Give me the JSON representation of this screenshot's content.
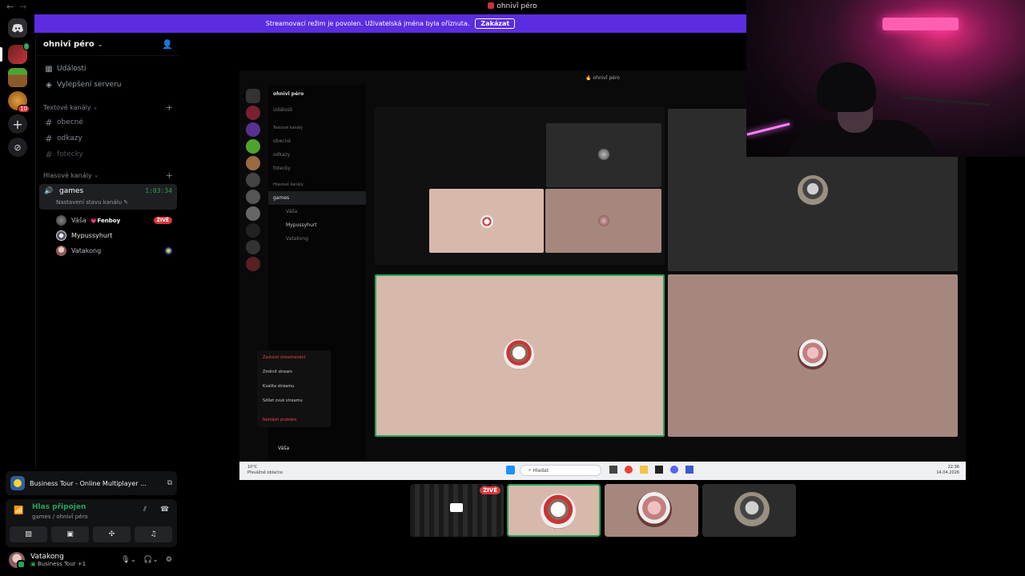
{
  "window": {
    "title": "ohnivî péro"
  },
  "banner": {
    "text": "Streamovací režim je povolen. Uživatelská jména byla oříznuta.",
    "button": "Zakázat"
  },
  "sidebar": {
    "server_name": "ohnivî péro",
    "nav": [
      {
        "label": "Události",
        "icon": "calendar-icon"
      },
      {
        "label": "Vylepšení serveru",
        "icon": "boost-icon"
      }
    ],
    "text_category": "Textové kanály",
    "text_channels": [
      "obecné",
      "odkazy",
      "fotecky"
    ],
    "voice_category": "Hlasové kanály",
    "voice_channel": {
      "name": "games",
      "time": "1:03:34",
      "status": "Nastavení stavu kanálu"
    },
    "voice_users": [
      {
        "name": "Váša",
        "activity": "Fenboy",
        "live": "ŽIVĚ"
      },
      {
        "name": "Mypussyhurt"
      },
      {
        "name": "Vatakong"
      }
    ]
  },
  "panel": {
    "activity": "Business Tour - Online Multiplayer ...",
    "voice_status": "Hlas připojen",
    "voice_location": "games / ohnivî péro",
    "user_name": "Vatakong",
    "user_status": "Business Tour +1"
  },
  "stream": {
    "inner_title": "ohnivî péro",
    "inner_server": "ohnivî péro",
    "inner_events": "Události",
    "inner_text_category": "Textové kanály",
    "inner_channels": [
      "obecné",
      "odkazy",
      "fotecky"
    ],
    "inner_voice_category": "Hlasové kanály",
    "inner_voice": "games",
    "inner_users": [
      "Váša",
      "Mypussyhurt",
      "Vatakong"
    ],
    "menu": [
      "Zastavit streamování",
      "Změnit stream",
      "Kvalita streamu",
      "Sdílet zvuk streamu",
      "Nahlásit problém"
    ],
    "inner_user": "Váša",
    "taskbar_search": "Hledat",
    "weather": "10°C",
    "weather_desc": "Převážně oblačno",
    "clock_time": "22:36",
    "clock_date": "14.04.2026"
  },
  "thumbs": {
    "live_label": "ŽIVĚ"
  },
  "colors": {
    "accent": "#5c2de0",
    "green": "#23a55a",
    "red": "#da373c",
    "tile_light": "#d7b9ac",
    "tile_dark": "#a6877d"
  }
}
